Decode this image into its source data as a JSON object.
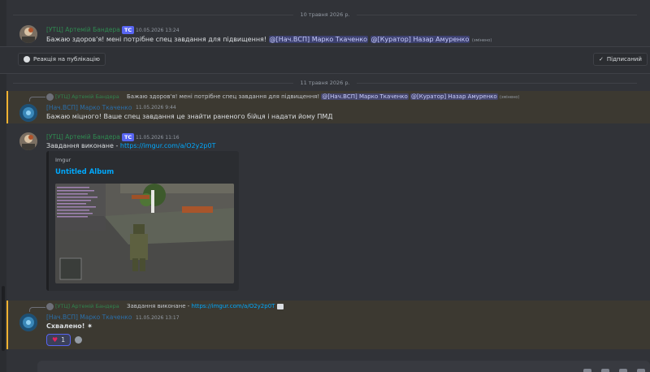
{
  "dividers": {
    "first": "10 травня 2026 р.",
    "second": "11 травня 2026 р."
  },
  "post": {
    "author": "[УТЦ] Артемій Бандера",
    "tag": "TC",
    "time": "10.05.2026 13:24",
    "text_prefix": "Бажаю здоров'я! мені потрібне спец завдання для підвищення!",
    "mention1": "@[Нач.ВСП] Марко Ткаченко",
    "mention2": "@[Куратор] Назар Амуренко",
    "edited": "(змінено)"
  },
  "thread_bar": {
    "react_label": "Реакція на публікацію",
    "follow_label": "Підписаний"
  },
  "msg1": {
    "reply_name": "[УТЦ] Артемій Бандера",
    "reply_prefix": "Бажаю здоров'я! мені потрібне спец завдання для підвищення!",
    "reply_mention1": "@[Нач.ВСП] Марко Ткаченко",
    "reply_mention2": "@[Куратор] Назар Амуренко",
    "reply_edited": "(змінено)",
    "author": "[Нач.ВСП] Марко Ткаченко",
    "time": "11.05.2026 9:44",
    "text": "Бажаю міцного! Ваше спец завдання це знайти раненого бійця і надати йому ПМД"
  },
  "msg2": {
    "author": "[УТЦ] Артемій Бандера",
    "tag": "TC",
    "time": "11.05.2026 11:16",
    "text_prefix": "Завдання виконане - ",
    "link": "https://imgur.com/a/O2y2p0T",
    "embed_provider": "Imgur",
    "embed_title": "Untitled Album"
  },
  "msg3": {
    "reply_name": "[УТЦ] Артемій Бандера",
    "reply_prefix": "Завдання виконане - ",
    "reply_link": "https://imgur.com/a/O2y2p0T",
    "author": "[Нач.ВСП] Марко Ткаченко",
    "time": "11.05.2026 13:17",
    "text": "Схвалено!",
    "reaction_count": "1"
  },
  "colors": {
    "background": "#313338",
    "mention": "#5865f2",
    "highlight_border": "#f0b232",
    "link": "#00a8fc",
    "author_green": "#2f8a51"
  }
}
